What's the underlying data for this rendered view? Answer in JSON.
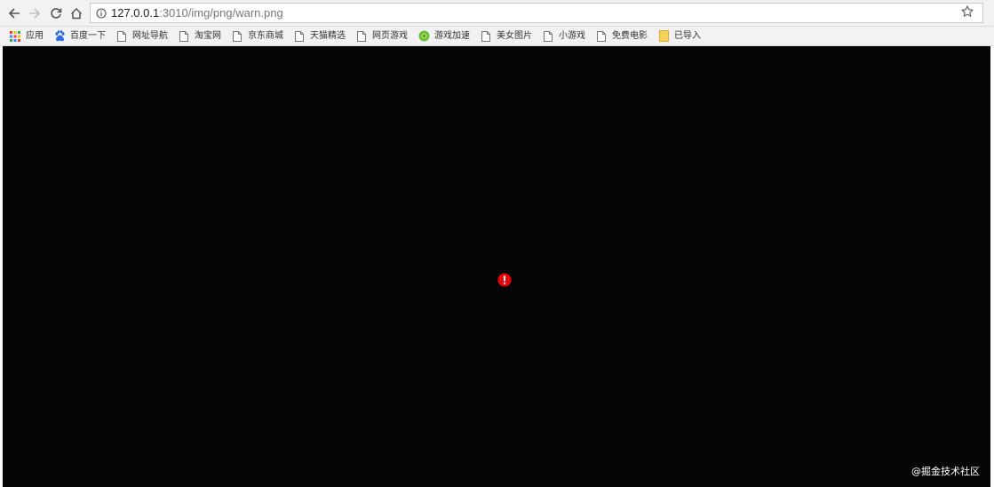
{
  "address_bar": {
    "url_host": "127.0.0.1",
    "url_rest": ":3010/img/png/warn.png"
  },
  "icons": {
    "back": "arrow-left-icon",
    "forward": "arrow-right-icon",
    "reload": "reload-icon",
    "home": "home-icon",
    "info": "info-icon",
    "star": "star-icon",
    "apps": "apps-grid-icon",
    "page": "page-icon",
    "folder": "folder-icon"
  },
  "bookmarks": [
    {
      "label": "应用",
      "icon": "apps-grid-icon"
    },
    {
      "label": "百度一下",
      "icon": "baidu-paw-icon"
    },
    {
      "label": "网址导航",
      "icon": "page-icon"
    },
    {
      "label": "淘宝网",
      "icon": "page-icon"
    },
    {
      "label": "京东商城",
      "icon": "page-icon"
    },
    {
      "label": "天猫精选",
      "icon": "page-icon"
    },
    {
      "label": "网页游戏",
      "icon": "page-icon"
    },
    {
      "label": "游戏加速",
      "icon": "game-accelerator-icon"
    },
    {
      "label": "美女图片",
      "icon": "page-icon"
    },
    {
      "label": "小游戏",
      "icon": "page-icon"
    },
    {
      "label": "免费电影",
      "icon": "page-icon"
    },
    {
      "label": "已导入",
      "icon": "folder-icon"
    }
  ],
  "page": {
    "background": "#050505",
    "warn_color": "#e8000b",
    "watermark": "@掘金技术社区"
  }
}
